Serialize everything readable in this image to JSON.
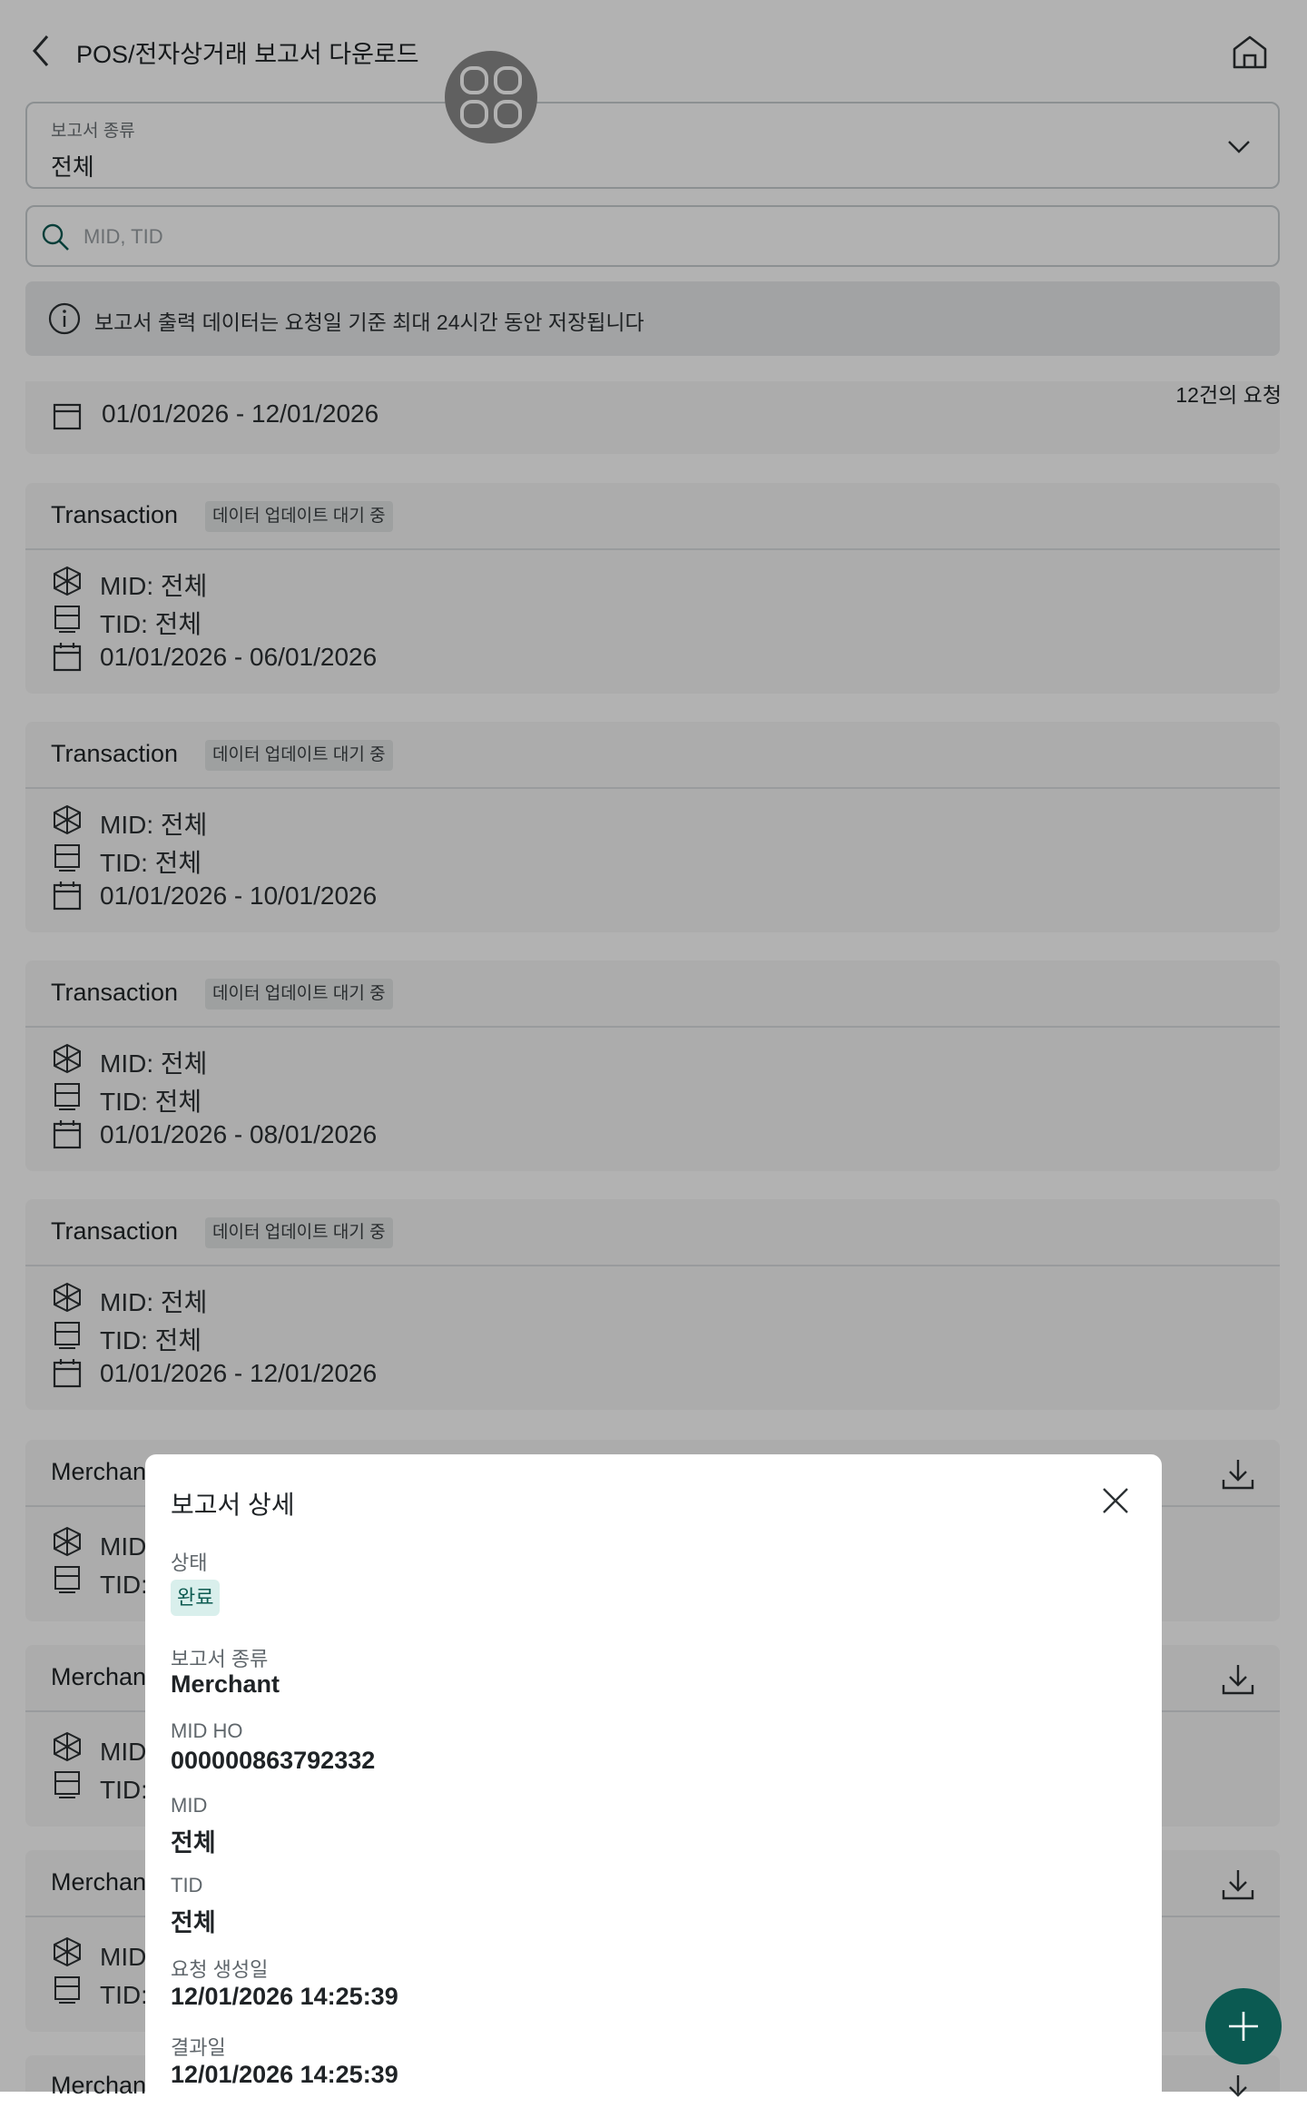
{
  "header": {
    "title": "POS/전자상거래 보고서 다운로드"
  },
  "filter": {
    "report_type_label": "보고서 종류",
    "report_type_value": "전체",
    "search_placeholder": "MID, TID"
  },
  "info_banner": {
    "text": "보고서 출력 데이터는 요청일 기준 최대 24시간 동안 저장됩니다"
  },
  "request_count": "12건의 요청",
  "partial_card": {
    "date_range": "01/01/2026 - 12/01/2026"
  },
  "cards": [
    {
      "title": "Transaction",
      "status": "데이터 업데이트 대기 중",
      "mid": "MID: 전체",
      "tid": "TID: 전체",
      "date_range": "01/01/2026 - 06/01/2026"
    },
    {
      "title": "Transaction",
      "status": "데이터 업데이트 대기 중",
      "mid": "MID: 전체",
      "tid": "TID: 전체",
      "date_range": "01/01/2026 - 10/01/2026"
    },
    {
      "title": "Transaction",
      "status": "데이터 업데이트 대기 중",
      "mid": "MID: 전체",
      "tid": "TID: 전체",
      "date_range": "01/01/2026 - 08/01/2026"
    },
    {
      "title": "Transaction",
      "status": "데이터 업데이트 대기 중",
      "mid": "MID: 전체",
      "tid": "TID: 전체",
      "date_range": "01/01/2026 - 12/01/2026"
    },
    {
      "title": "Merchant",
      "mid": "MID: 전체",
      "tid": "TID: 전체"
    },
    {
      "title": "Merchant",
      "mid": "MID: 전체",
      "tid": "TID: 전체"
    },
    {
      "title": "Merchant",
      "mid": "MID: 전체",
      "tid": "TID: 전체"
    },
    {
      "title": "Merchant"
    }
  ],
  "dialog": {
    "title": "보고서 상세",
    "status_label": "상태",
    "status_value": "완료",
    "report_type_label": "보고서 종류",
    "report_type_value": "Merchant",
    "mid_ho_label": "MID HO",
    "mid_ho_value": "000000863792332",
    "mid_label": "MID",
    "mid_value": "전체",
    "tid_label": "TID",
    "tid_value": "전체",
    "created_label": "요청 생성일",
    "created_value": "12/01/2026 14:25:39",
    "result_label": "결과일",
    "result_value": "12/01/2026 14:25:39"
  },
  "colors": {
    "accent": "#0b5a52",
    "status_done_bg": "#d9efec",
    "status_done_text": "#0d5b51"
  }
}
